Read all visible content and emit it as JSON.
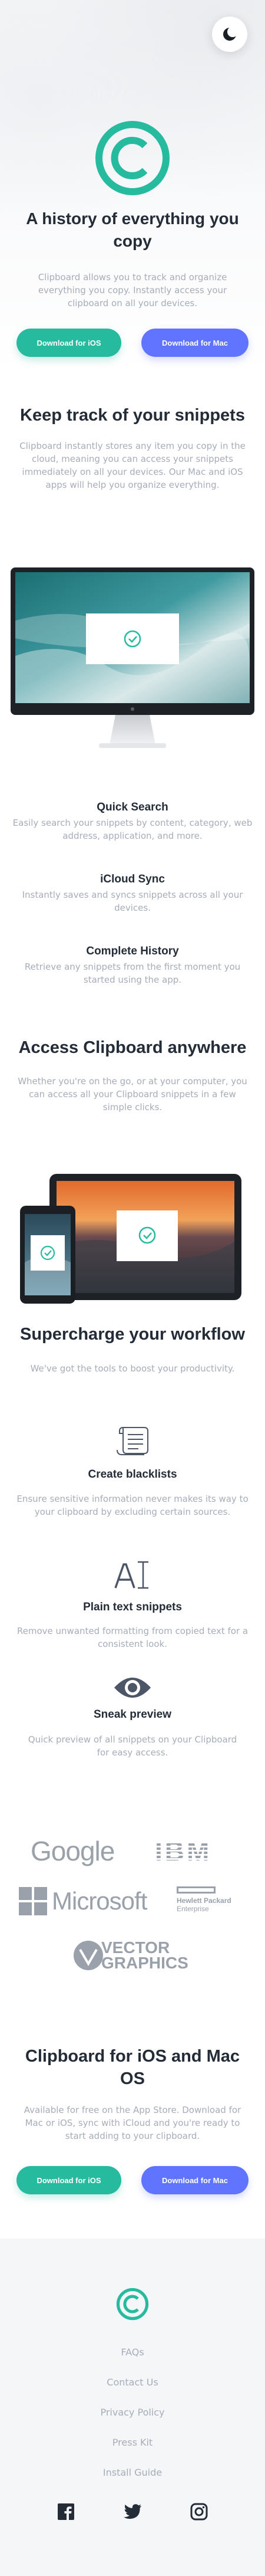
{
  "hero": {
    "title": "A history of everything you copy",
    "text": "Clipboard allows you to track and organize everything you copy. Instantly access your clipboard on all your devices.",
    "btn_ios": "Download for iOS",
    "btn_mac": "Download for Mac",
    "toggle_icon": "moon-icon"
  },
  "snippets": {
    "title": "Keep track of your snippets",
    "text": "Clipboard instantly stores any item you copy in the cloud, meaning you can access your snippets immediately on all your devices. Our Mac and iOS apps will help you organize everything."
  },
  "features": [
    {
      "title": "Quick Search",
      "text": "Easily search your snippets by content, category, web address, application, and more."
    },
    {
      "title": "iCloud Sync",
      "text": "Instantly saves and syncs snippets across all your devices."
    },
    {
      "title": "Complete History",
      "text": "Retrieve any snippets from the first moment you started using the app."
    }
  ],
  "access": {
    "title": "Access Clipboard anywhere",
    "text": "Whether you're on the go, or at your computer, you can access all your Clipboard snippets in a few simple clicks."
  },
  "workflow": {
    "title": "Supercharge your workflow",
    "text": "We've got the tools to boost your productivity.",
    "items": [
      {
        "icon": "blacklist-icon",
        "title": "Create blacklists",
        "text": "Ensure sensitive information never makes its way to your clipboard by excluding certain sources."
      },
      {
        "icon": "text-icon",
        "title": "Plain text snippets",
        "text": "Remove unwanted formatting from copied text for a consistent look."
      },
      {
        "icon": "preview-icon",
        "title": "Sneak preview",
        "text": "Quick preview of all snippets on your Clipboard for easy access."
      }
    ]
  },
  "partners": {
    "google": "Google",
    "ibm": "IBM",
    "microsoft": "Microsoft",
    "hp_line1": "Hewlett Packard",
    "hp_line2": "Enterprise",
    "vector_line1": "VECTOR",
    "vector_line2": "GRAPHICS"
  },
  "cta": {
    "title": "Clipboard for iOS and Mac OS",
    "text": "Available for free on the App Store. Download for Mac or iOS, sync with iCloud and you're ready to start adding to your clipboard.",
    "btn_ios": "Download for iOS",
    "btn_mac": "Download for Mac"
  },
  "footer": {
    "links": [
      "FAQs",
      "Contact Us",
      "Privacy Policy",
      "Press Kit",
      "Install Guide"
    ],
    "social": [
      "facebook-icon",
      "twitter-icon",
      "instagram-icon"
    ]
  },
  "colors": {
    "teal": "#26ba9f",
    "blue": "#6174ff",
    "heading": "#242c37",
    "body_text": "#a6adb8"
  }
}
